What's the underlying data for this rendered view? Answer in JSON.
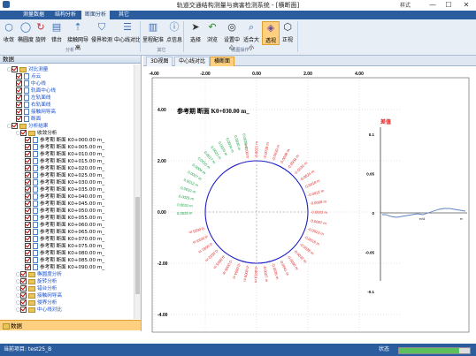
{
  "window": {
    "title": "轨道交通结构测量与病害检测系统 - [横断面]",
    "user_label": "样式",
    "minimize": "—",
    "maximize": "☐",
    "close": "✕"
  },
  "menu_tabs": [
    "测量数据",
    "结构分析",
    "断面分析",
    "其它"
  ],
  "menu_active": 2,
  "ribbon": {
    "buttons": [
      {
        "label": "收敛",
        "icon": "convergence-icon"
      },
      {
        "label": "椭圆度",
        "icon": "ellipse-icon"
      },
      {
        "label": "旋转",
        "icon": "rotate-icon"
      },
      {
        "label": "错台",
        "icon": "misalign-icon"
      },
      {
        "label": "接触网导高",
        "icon": "catenary-icon"
      },
      {
        "label": "侵界检测",
        "icon": "clearance-icon"
      },
      {
        "label": "中心线对比",
        "icon": "centerline-icon"
      },
      {
        "label": "里程配准",
        "icon": "mileage-icon"
      },
      {
        "label": "点信息",
        "icon": "info-icon"
      },
      {
        "label": "选择",
        "icon": "select-icon"
      },
      {
        "label": "浏览",
        "icon": "pan-icon"
      },
      {
        "label": "设置中心",
        "icon": "target-icon"
      },
      {
        "label": "适合大小",
        "icon": "zoom-fit-icon"
      },
      {
        "label": "透视",
        "icon": "perspective-icon"
      },
      {
        "label": "正视",
        "icon": "cube-icon"
      }
    ],
    "groups": [
      "分析",
      "其它",
      "视图操作"
    ]
  },
  "left_panel": {
    "title": "数据",
    "footer": "数据",
    "tree": [
      {
        "label": "对比测量",
        "level": 1,
        "kind": "folder",
        "blue": true
      },
      {
        "label": "点云",
        "level": 2,
        "kind": "doc",
        "blue": true
      },
      {
        "label": "中心线",
        "level": 2,
        "kind": "doc",
        "blue": true
      },
      {
        "label": "轨面中心线",
        "level": 2,
        "kind": "doc",
        "blue": true
      },
      {
        "label": "左轨面线",
        "level": 2,
        "kind": "doc",
        "blue": true
      },
      {
        "label": "右轨面线",
        "level": 2,
        "kind": "doc",
        "blue": true
      },
      {
        "label": "接触网导高",
        "level": 2,
        "kind": "doc",
        "blue": true
      },
      {
        "label": "断面",
        "level": 2,
        "kind": "doc",
        "blue": true
      },
      {
        "label": "分析结果",
        "level": 1,
        "kind": "folder",
        "blue": true
      },
      {
        "label": "收敛分析",
        "level": 2,
        "kind": "folder",
        "blue": false
      },
      {
        "label": "参考期 断面 K0+000.00 m_",
        "level": 3,
        "kind": "doc",
        "blue": false
      },
      {
        "label": "参考期 断面 K0+005.00 m_",
        "level": 3,
        "kind": "doc",
        "blue": false
      },
      {
        "label": "参考期 断面 K0+010.00 m_",
        "level": 3,
        "kind": "doc",
        "blue": false
      },
      {
        "label": "参考期 断面 K0+015.00 m_",
        "level": 3,
        "kind": "doc",
        "blue": false
      },
      {
        "label": "参考期 断面 K0+020.00 m_",
        "level": 3,
        "kind": "doc",
        "blue": false
      },
      {
        "label": "参考期 断面 K0+025.00 m_",
        "level": 3,
        "kind": "doc",
        "blue": false
      },
      {
        "label": "参考期 断面 K0+030.00 m_",
        "level": 3,
        "kind": "doc",
        "blue": false
      },
      {
        "label": "参考期 断面 K0+035.00 m_",
        "level": 3,
        "kind": "doc",
        "blue": false
      },
      {
        "label": "参考期 断面 K0+040.00 m_",
        "level": 3,
        "kind": "doc",
        "blue": false
      },
      {
        "label": "参考期 断面 K0+045.00 m_",
        "level": 3,
        "kind": "doc",
        "blue": false
      },
      {
        "label": "参考期 断面 K0+050.00 m_",
        "level": 3,
        "kind": "doc",
        "blue": false
      },
      {
        "label": "参考期 断面 K0+055.00 m_",
        "level": 3,
        "kind": "doc",
        "blue": false
      },
      {
        "label": "参考期 断面 K0+060.00 m_",
        "level": 3,
        "kind": "doc",
        "blue": false
      },
      {
        "label": "参考期 断面 K0+065.00 m_",
        "level": 3,
        "kind": "doc",
        "blue": false
      },
      {
        "label": "参考期 断面 K0+070.00 m_",
        "level": 3,
        "kind": "doc",
        "blue": false
      },
      {
        "label": "参考期 断面 K0+075.00 m_",
        "level": 3,
        "kind": "doc",
        "blue": false
      },
      {
        "label": "参考期 断面 K0+080.00 m_",
        "level": 3,
        "kind": "doc",
        "blue": false
      },
      {
        "label": "参考期 断面 K0+085.00 m_",
        "level": 3,
        "kind": "doc",
        "blue": false
      },
      {
        "label": "参考期 断面 K0+090.00 m_",
        "level": 3,
        "kind": "doc",
        "blue": false
      },
      {
        "label": "椭圆度分析",
        "level": 2,
        "kind": "folder",
        "blue": true
      },
      {
        "label": "旋转分析",
        "level": 2,
        "kind": "folder",
        "blue": true
      },
      {
        "label": "错台分析",
        "level": 2,
        "kind": "folder",
        "blue": true
      },
      {
        "label": "接触网导高",
        "level": 2,
        "kind": "folder",
        "blue": true
      },
      {
        "label": "侵界分析",
        "level": 2,
        "kind": "folder",
        "blue": true
      },
      {
        "label": "中心线对比",
        "level": 2,
        "kind": "folder",
        "blue": true
      }
    ]
  },
  "doc_tabs": [
    "3D视图",
    "中心线对比",
    "横断面"
  ],
  "doc_active": 2,
  "plot": {
    "title": "参考期 断面 K0+030.00 m_",
    "diff_label": "差值",
    "x_ticks": [
      "-4.00",
      "-2.00",
      "0.00",
      "2.00",
      "4.00"
    ],
    "y_ticks": [
      "4.00",
      "2.00",
      "0.00",
      "-2.00",
      "-4.00"
    ],
    "side_ticks": [
      "0.1",
      "0.05",
      "0",
      "-0.05",
      "-0.1"
    ],
    "side_marks": [
      "π/4",
      "π"
    ],
    "labels_red": [
      "-0.0011 m",
      "-0.0021 m",
      "-0.0029 m",
      "-0.0039 m",
      "-0.0038 m",
      "-0.0034 m",
      "-0.0030 m",
      "-0.0024 m",
      "-0.0018 m",
      "-0.0012 m",
      "-0.0008 m",
      "-0.0002 m",
      "-0.0007 m",
      "-0.0013 m",
      "-0.0018 m",
      "-0.0028 m",
      "-0.0032 m",
      "-0.0036 m",
      "-0.0041 m",
      "-0.0035 m",
      "-0.0027 m",
      "-0.0019 m",
      "-0.0009 m",
      "-0.0004 m",
      "-0.0006 m",
      "-0.0015 m",
      "-0.0022 m",
      "-0.0031 m",
      "-0.0033 m",
      "-0.0025 m"
    ],
    "labels_green": [
      "0.0028 m",
      "0.0031 m",
      "0.0025 m",
      "0.0019 m",
      "0.0012 m",
      "0.0007 m",
      "0.0004 m",
      "0.0010 m",
      "0.0017 m",
      "0.0023 m",
      "0.0029 m",
      "0.0034 m",
      "0.0030 m",
      "0.0026 m"
    ]
  },
  "status": {
    "project": "当前项目: test25_B",
    "state": "状态",
    "progress": 0.85
  },
  "colors": {
    "accent": "#2a5c9e",
    "ribbon_bg": "#e8eef6",
    "highlight": "#ffd080",
    "circle": "#1e1ec8",
    "neg": "#e02020",
    "pos": "#10a040"
  }
}
